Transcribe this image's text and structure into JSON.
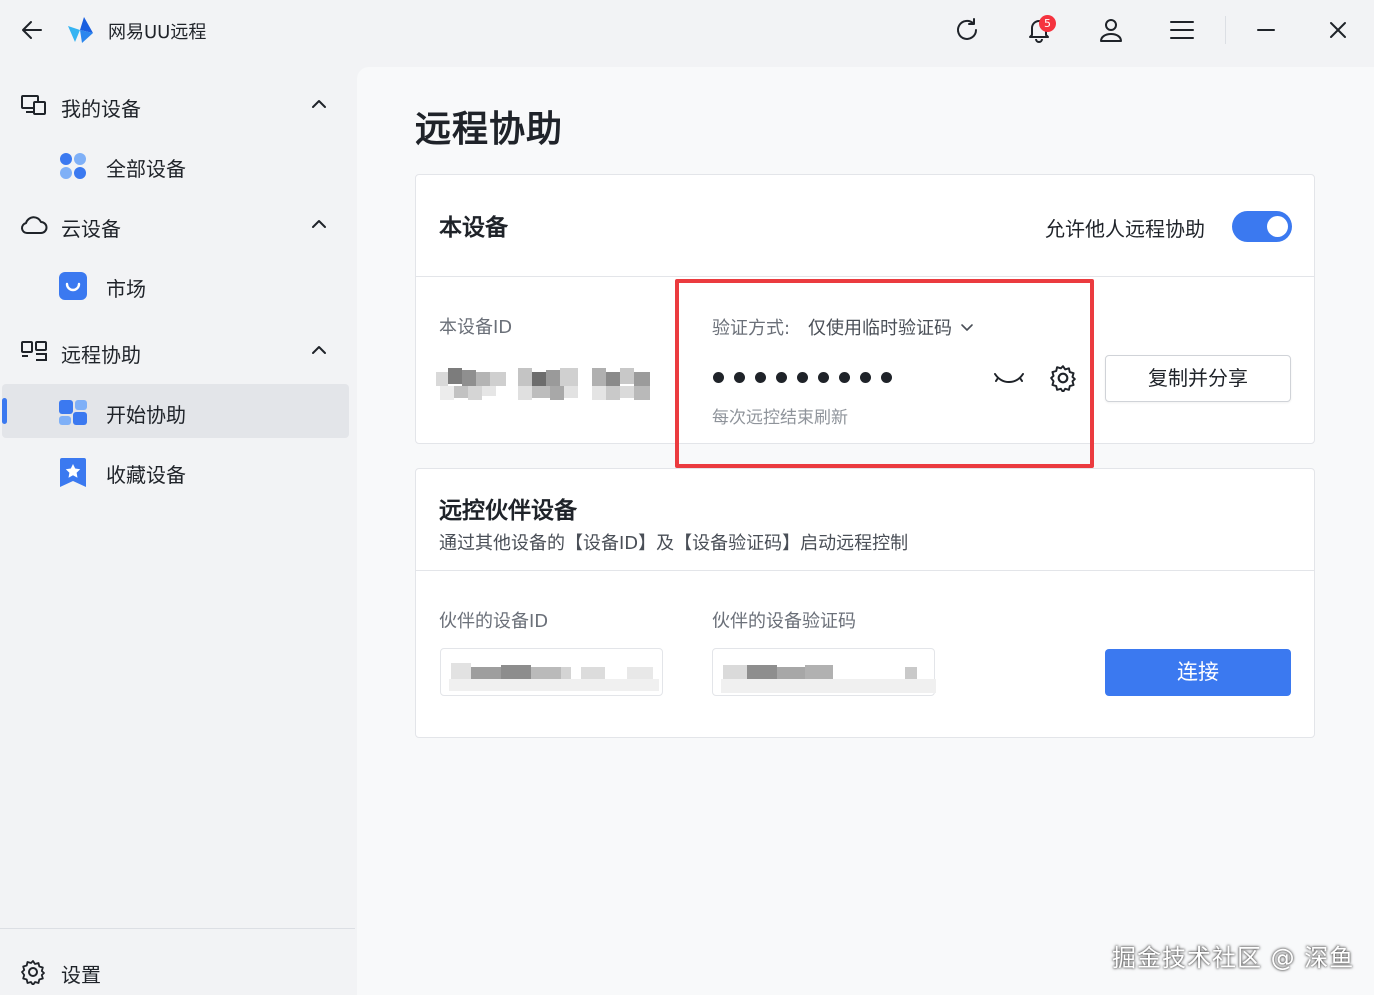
{
  "titlebar": {
    "app_name": "网易UU远程",
    "notification_count": "5",
    "icons": [
      "back-arrow-icon",
      "app-logo-icon",
      "refresh-icon",
      "bell-icon",
      "user-icon",
      "menu-icon",
      "minimize-icon",
      "close-icon"
    ]
  },
  "sidebar": {
    "groups": [
      {
        "label": "我的设备",
        "icon": "devices-icon",
        "items": [
          {
            "label": "全部设备",
            "icon": "all-devices-icon"
          }
        ]
      },
      {
        "label": "云设备",
        "icon": "cloud-icon",
        "items": [
          {
            "label": "市场",
            "icon": "market-bag-icon"
          }
        ]
      },
      {
        "label": "远程协助",
        "icon": "remote-assist-icon",
        "items": [
          {
            "label": "开始协助",
            "icon": "start-assist-icon",
            "active": true
          },
          {
            "label": "收藏设备",
            "icon": "star-bookmark-icon"
          }
        ]
      }
    ],
    "settings_label": "设置"
  },
  "main": {
    "title": "远程协助",
    "this_device": {
      "title": "本设备",
      "allow_label": "允许他人远程协助",
      "allow_enabled": true,
      "device_id_label": "本设备ID",
      "device_id_value": "(blurred)",
      "verify_label": "验证方式:",
      "verify_mode": "仅使用临时验证码",
      "password_mask": "●●●●●●●●●",
      "refresh_hint": "每次远控结束刷新",
      "copy_share_button": "复制并分享"
    },
    "partner": {
      "title": "远控伙伴设备",
      "subtitle": "通过其他设备的【设备ID】及【设备验证码】启动远程控制",
      "id_label": "伙伴的设备ID",
      "code_label": "伙伴的设备验证码",
      "connect_button": "连接"
    }
  },
  "watermark": "掘金技术社区 @ 深鱼",
  "colors": {
    "accent": "#3b79f0",
    "highlight": "#eb3b3f",
    "badge": "#f5333f"
  }
}
